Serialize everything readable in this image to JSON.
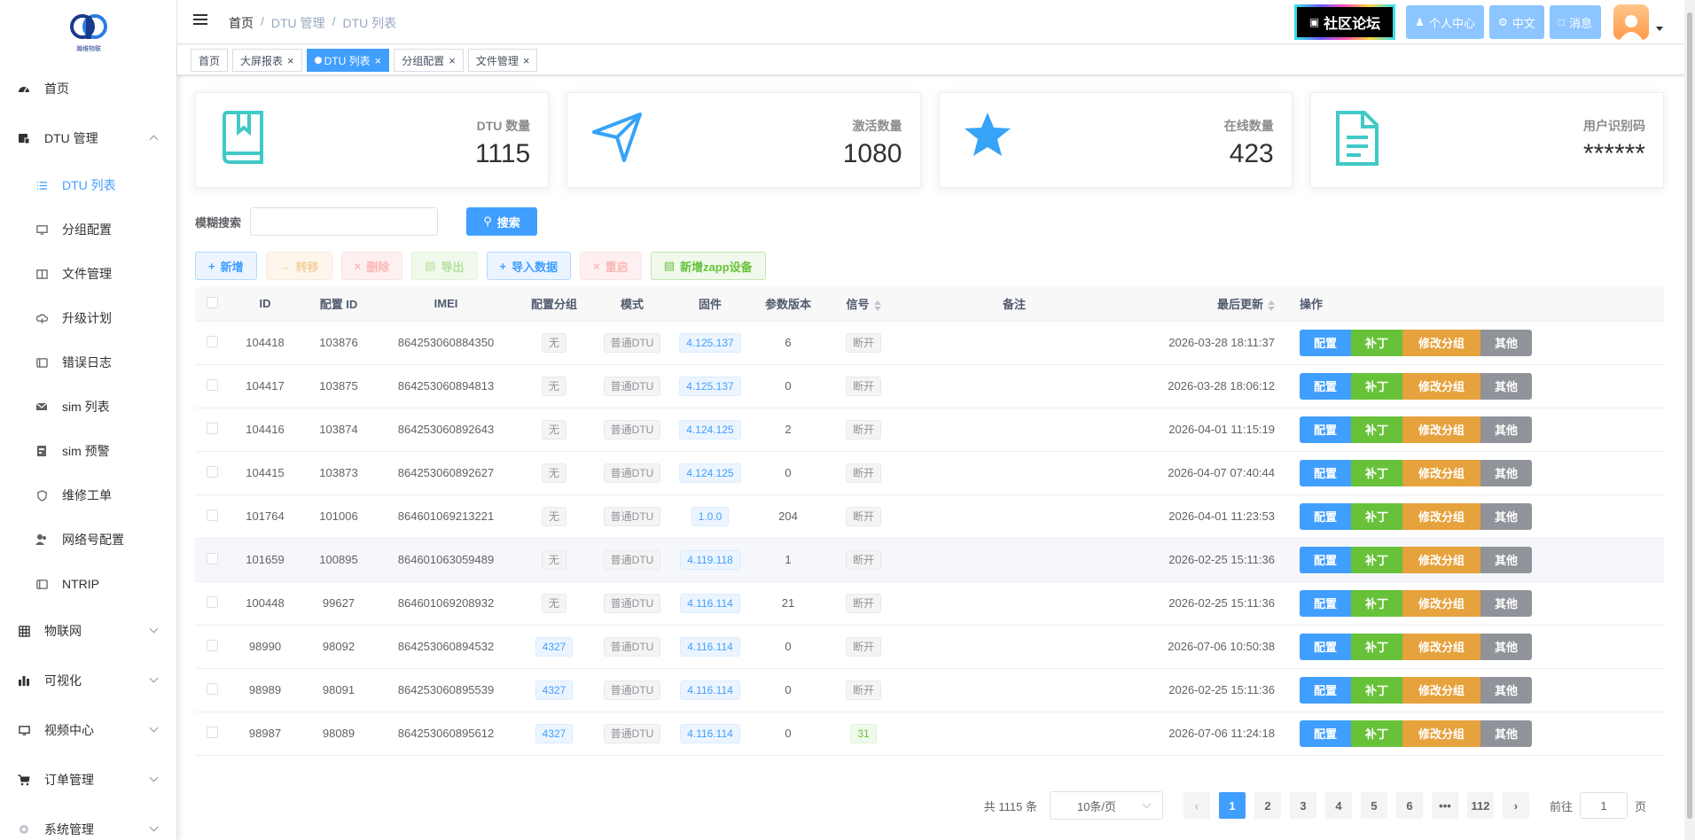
{
  "sidebar": {
    "logo_text": "瀚维物联",
    "items": [
      {
        "label": "首页",
        "icon": "dashboard-icon"
      },
      {
        "label": "DTU 管理",
        "icon": "server-icon"
      }
    ],
    "sub_items": [
      {
        "label": "DTU 列表",
        "icon": "list-icon"
      },
      {
        "label": "分组配置",
        "icon": "monitor-icon"
      },
      {
        "label": "文件管理",
        "icon": "book-icon"
      },
      {
        "label": "升级计划",
        "icon": "cloud-upload-icon"
      },
      {
        "label": "错误日志",
        "icon": "log-icon"
      },
      {
        "label": "sim 列表",
        "icon": "mail-icon"
      },
      {
        "label": "sim 预警",
        "icon": "warning-card-icon"
      },
      {
        "label": "维修工单",
        "icon": "shield-icon"
      },
      {
        "label": "网络号配置",
        "icon": "users-icon"
      },
      {
        "label": "NTRIP",
        "icon": "log-icon"
      }
    ],
    "bottom_items": [
      {
        "label": "物联网",
        "icon": "grid-icon"
      },
      {
        "label": "可视化",
        "icon": "bar-chart-icon"
      },
      {
        "label": "视频中心",
        "icon": "monitor-icon"
      },
      {
        "label": "订单管理",
        "icon": "cart-icon"
      },
      {
        "label": "系统管理",
        "icon": "gear-icon"
      }
    ]
  },
  "header": {
    "breadcrumb": [
      "首页",
      "DTU 管理",
      "DTU 列表"
    ],
    "forum_label": "社区论坛",
    "personal_label": "个人中心",
    "lang_label": "中文",
    "msg_label": "消息"
  },
  "tags": [
    {
      "label": "首页",
      "closable": false,
      "active": false
    },
    {
      "label": "大屏报表",
      "closable": true,
      "active": false
    },
    {
      "label": "DTU 列表",
      "closable": true,
      "active": true
    },
    {
      "label": "分组配置",
      "closable": true,
      "active": false
    },
    {
      "label": "文件管理",
      "closable": true,
      "active": false
    }
  ],
  "cards": [
    {
      "label": "DTU 数量",
      "value": "1115",
      "icon": "book-icon"
    },
    {
      "label": "激活数量",
      "value": "1080",
      "icon": "send-icon"
    },
    {
      "label": "在线数量",
      "value": "423",
      "icon": "star-icon"
    },
    {
      "label": "用户识别码",
      "value": "******",
      "icon": "document-icon"
    }
  ],
  "search": {
    "label": "模糊搜索",
    "placeholder": "",
    "button": "搜索"
  },
  "toolbar": {
    "add": "新增",
    "move": "转移",
    "delete": "删除",
    "export": "导出",
    "import": "导入数据",
    "restart": "重启",
    "add_zapp": "新增zapp设备"
  },
  "table": {
    "headers": {
      "id": "ID",
      "config_id": "配置 ID",
      "imei": "IMEI",
      "group": "配置分组",
      "mode": "模式",
      "firmware": "固件",
      "param_ver": "参数版本",
      "signal": "信号",
      "remark": "备注",
      "updated": "最后更新",
      "ops": "操作"
    },
    "op_labels": {
      "config": "配置",
      "patch": "补丁",
      "edit_group": "修改分组",
      "other": "其他"
    },
    "rows": [
      {
        "id": "104418",
        "config_id": "103876",
        "imei": "864253060884350",
        "group": "无",
        "mode": "普通DTU",
        "firmware": "4.125.137",
        "param_ver": "6",
        "signal": "断开",
        "remark": "",
        "updated": "2026-03-28 18:11:37"
      },
      {
        "id": "104417",
        "config_id": "103875",
        "imei": "864253060894813",
        "group": "无",
        "mode": "普通DTU",
        "firmware": "4.125.137",
        "param_ver": "0",
        "signal": "断开",
        "remark": "",
        "updated": "2026-03-28 18:06:12"
      },
      {
        "id": "104416",
        "config_id": "103874",
        "imei": "864253060892643",
        "group": "无",
        "mode": "普通DTU",
        "firmware": "4.124.125",
        "param_ver": "2",
        "signal": "断开",
        "remark": "",
        "updated": "2026-04-01 11:15:19"
      },
      {
        "id": "104415",
        "config_id": "103873",
        "imei": "864253060892627",
        "group": "无",
        "mode": "普通DTU",
        "firmware": "4.124.125",
        "param_ver": "0",
        "signal": "断开",
        "remark": "",
        "updated": "2026-04-07 07:40:44"
      },
      {
        "id": "101764",
        "config_id": "101006",
        "imei": "864601069213221",
        "group": "无",
        "mode": "普通DTU",
        "firmware": "1.0.0",
        "param_ver": "204",
        "signal": "断开",
        "remark": "",
        "updated": "2026-04-01 11:23:53"
      },
      {
        "id": "101659",
        "config_id": "100895",
        "imei": "864601063059489",
        "group": "无",
        "mode": "普通DTU",
        "firmware": "4.119.118",
        "param_ver": "1",
        "signal": "断开",
        "remark": "",
        "updated": "2026-02-25 15:11:36"
      },
      {
        "id": "100448",
        "config_id": "99627",
        "imei": "864601069208932",
        "group": "无",
        "mode": "普通DTU",
        "firmware": "4.116.114",
        "param_ver": "21",
        "signal": "断开",
        "remark": "",
        "updated": "2026-02-25 15:11:36"
      },
      {
        "id": "98990",
        "config_id": "98092",
        "imei": "864253060894532",
        "group": "4327",
        "mode": "普通DTU",
        "firmware": "4.116.114",
        "param_ver": "0",
        "signal": "断开",
        "remark": "",
        "updated": "2026-07-06 10:50:38"
      },
      {
        "id": "98989",
        "config_id": "98091",
        "imei": "864253060895539",
        "group": "4327",
        "mode": "普通DTU",
        "firmware": "4.116.114",
        "param_ver": "0",
        "signal": "断开",
        "remark": "",
        "updated": "2026-02-25 15:11:36"
      },
      {
        "id": "98987",
        "config_id": "98089",
        "imei": "864253060895612",
        "group": "4327",
        "mode": "普通DTU",
        "firmware": "4.116.114",
        "param_ver": "0",
        "signal": "31",
        "remark": "",
        "updated": "2026-07-06 11:24:18"
      }
    ]
  },
  "pagination": {
    "total_label": "共 1115 条",
    "page_size": "10条/页",
    "pages": [
      "1",
      "2",
      "3",
      "4",
      "5",
      "6",
      "•••",
      "112"
    ],
    "current": "1",
    "goto_label": "前往",
    "goto_value": "1",
    "page_unit": "页"
  },
  "colors": {
    "primary": "#409eff",
    "success": "#67c23a",
    "warning": "#e6a23c",
    "info": "#909399",
    "teal_icon": "#40c9c6",
    "blue_icon": "#36a3f7"
  }
}
